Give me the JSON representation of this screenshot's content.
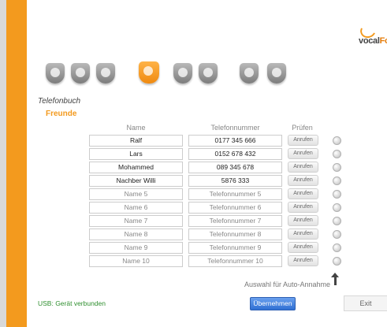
{
  "logo": {
    "text_main": "vocal",
    "text_accent": "Fon"
  },
  "nav_icons": [
    "info-icon",
    "contacts-icon",
    "id-card-icon",
    "phonebook-icon",
    "clock-icon",
    "settings-icon",
    "tools-icon",
    "checklist-icon"
  ],
  "active_nav_index": 3,
  "section_title": "Telefonbuch",
  "group_title": "Freunde",
  "columns": {
    "name": "Name",
    "phone": "Telefonnummer",
    "test": "Prüfen"
  },
  "call_label": "Anrufen",
  "contacts": [
    {
      "name": "Ralf",
      "phone": "0177 345 666",
      "filled": true
    },
    {
      "name": "Lars",
      "phone": "0152 678 432",
      "filled": true
    },
    {
      "name": "Mohammed",
      "phone": "089 345 678",
      "filled": true
    },
    {
      "name": "Nachber Willi",
      "phone": "5876 333",
      "filled": true
    },
    {
      "name": "Name 5",
      "phone": "Telefonnummer 5",
      "filled": false
    },
    {
      "name": "Name 6",
      "phone": "Telefonnummer 6",
      "filled": false
    },
    {
      "name": "Name 7",
      "phone": "Telefonnummer 7",
      "filled": false
    },
    {
      "name": "Name 8",
      "phone": "Telefonnummer 8",
      "filled": false
    },
    {
      "name": "Name 9",
      "phone": "Telefonnummer 9",
      "filled": false
    },
    {
      "name": "Name 10",
      "phone": "Telefonnummer 10",
      "filled": false
    }
  ],
  "auto_answer_label": "Auswahl für Auto-Annahme",
  "status": {
    "usb": "USB: Gerät verbunden"
  },
  "buttons": {
    "apply": "Übernehmen",
    "exit": "Exit"
  },
  "colors": {
    "accent": "#f39a1e",
    "status_ok": "#2f8f2f",
    "apply_button": "#3d7ee0"
  }
}
